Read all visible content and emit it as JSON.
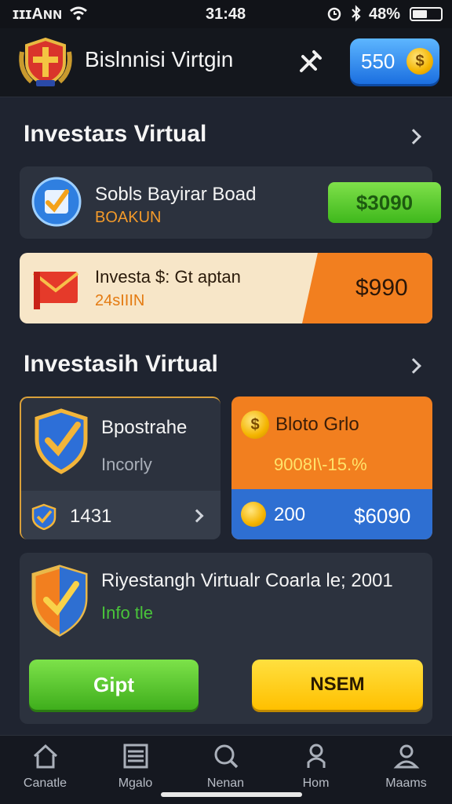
{
  "status_bar": {
    "carrier": "ɪɪɪAɴɴ",
    "time": "31:48",
    "battery": "48%"
  },
  "header": {
    "title": "Bislnnisi Virtgin",
    "coins": "550",
    "coin_symbol": "$"
  },
  "section1": {
    "title": "Investaɪs Virtual",
    "card1": {
      "title": "Sobls Bayirar Boad",
      "subtitle": "BOAKUN",
      "price": "$3090"
    },
    "card2": {
      "title": "Investa $: Gt aptan",
      "subtitle": "24sIIIN",
      "price": "$990"
    }
  },
  "section2": {
    "title": "Investasih Virtual",
    "card_left": {
      "title": "Bpostrahe",
      "subtitle": "Incorly",
      "count": "1431"
    },
    "card_right": {
      "title": "Bloto Grlo",
      "stat": "9008I\\-15.%",
      "coins": "200",
      "price": "$6090"
    }
  },
  "promo": {
    "title": "Riyestangh Virtualr Coarla le; 2001",
    "subtitle": "Info tle",
    "btn_green": "Gipt",
    "btn_yellow": "NSEM"
  },
  "nav": [
    {
      "label": "Canatle",
      "icon": "home-icon"
    },
    {
      "label": "Mgalo",
      "icon": "list-icon"
    },
    {
      "label": "Nenan",
      "icon": "search-icon"
    },
    {
      "label": "Hom",
      "icon": "person-icon"
    },
    {
      "label": "Maams",
      "icon": "profile-icon"
    }
  ],
  "colors": {
    "background": "#1f2430",
    "card": "#2c323e",
    "orange": "#f27f1f",
    "green": "#45bb22",
    "blue": "#2e6fd2",
    "yellow": "#ffc90a"
  }
}
